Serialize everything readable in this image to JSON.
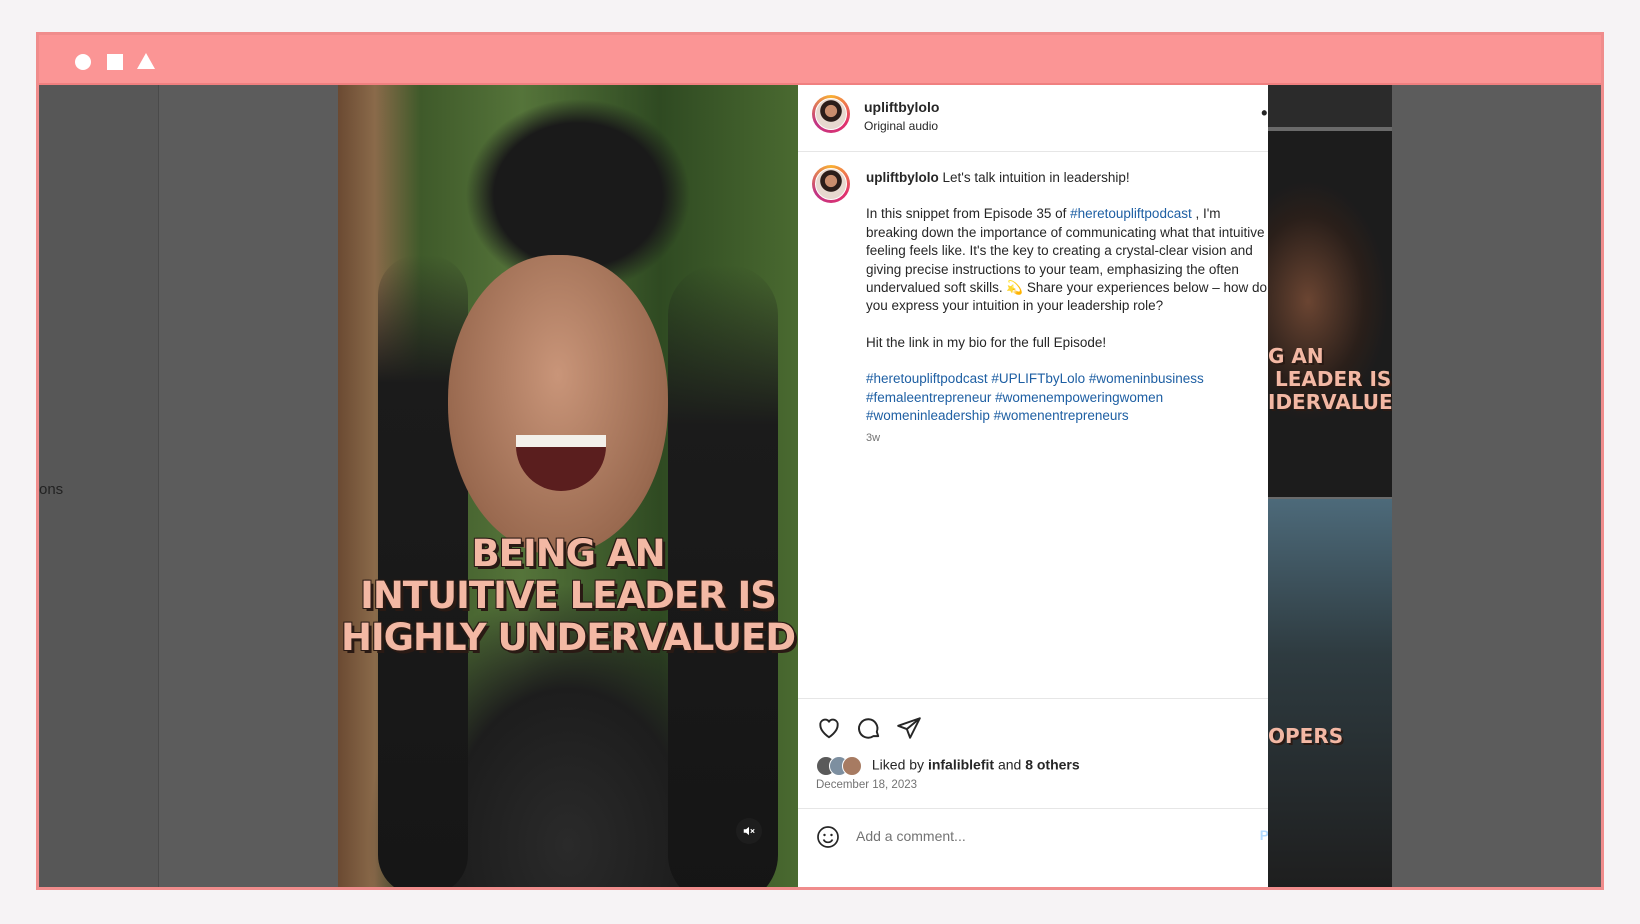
{
  "window_controls": [
    "circle",
    "square",
    "triangle"
  ],
  "sidebar_partial_text": "ons",
  "video": {
    "caption_lines": [
      "BEING AN",
      "INTUITIVE LEADER IS",
      "HIGHLY UNDERVALUED"
    ],
    "mute_icon": "muted-speaker-icon"
  },
  "side_thumbnails": {
    "thumb2_caption": "G AN\n LEADER IS\nIDERVALUED",
    "thumb3_caption": "OPERS"
  },
  "post": {
    "username": "upliftbylolo",
    "audio": "Original audio",
    "more_label": "•••",
    "caption": {
      "username": "upliftbylolo",
      "intro": "Let's talk intuition in leadership!",
      "p1_before": "In this snippet from Episode 35 of ",
      "p1_tag": "#heretoupliftpodcast",
      "p1_after": " , I'm breaking down the importance of communicating what that intuitive feeling feels like. It's the key to creating a crystal-clear vision and giving precise instructions to your team, emphasizing the often undervalued soft skills. 💫 Share your experiences below – how do you express your intuition in your leadership role?",
      "p2": "Hit the link in my bio for the full Episode!",
      "hashtags": [
        "#heretoupliftpodcast",
        "#UPLIFTbyLolo",
        "#womeninbusiness",
        "#femaleentrepreneur",
        "#womenempoweringwomen",
        "#womeninleadership",
        "#womenentrepreneurs"
      ],
      "time_ago": "3w"
    },
    "likes": {
      "prefix": "Liked by ",
      "liker": "infaliblefit",
      "middle": " and ",
      "others": "8 others"
    },
    "date": "December 18, 2023",
    "comment_placeholder": "Add a comment...",
    "post_button": "Post"
  },
  "colors": {
    "titlebar": "#fb9595",
    "link": "#1e5fa3",
    "caption_text": "#f3b8a4",
    "post_disabled": "#b3dbff"
  }
}
